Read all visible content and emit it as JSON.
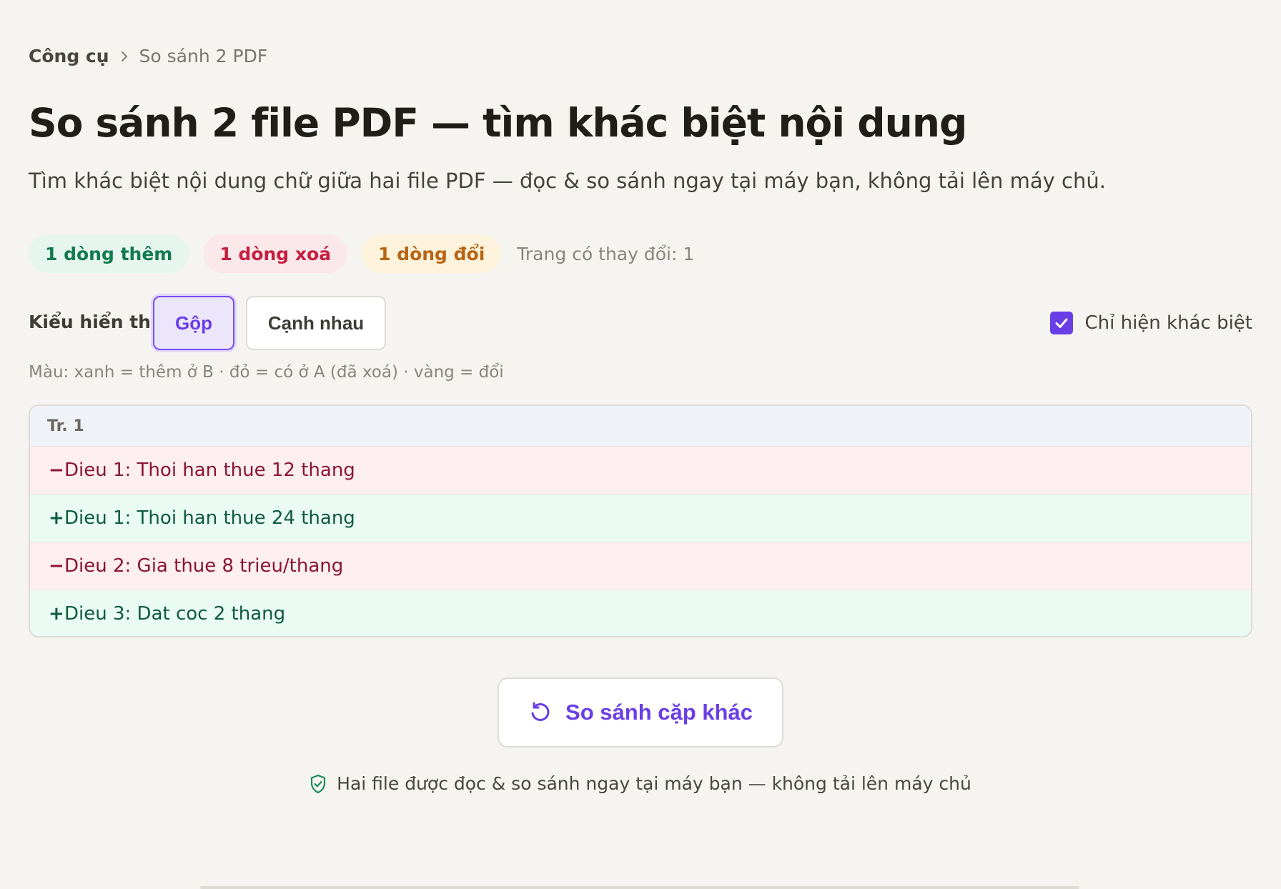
{
  "breadcrumb": {
    "parent": "Công cụ",
    "current": "So sánh 2 PDF"
  },
  "title": "So sánh 2 file PDF — tìm khác biệt nội dung",
  "subtitle": "Tìm khác biệt nội dung chữ giữa hai file PDF — đọc & so sánh ngay tại máy bạn, không tải lên máy chủ.",
  "summary": {
    "added": "1 dòng thêm",
    "removed": "1 dòng xoá",
    "changed": "1 dòng đổi",
    "pages_changed": "Trang có thay đổi: 1"
  },
  "view_mode": {
    "label": "Kiểu hiển thị",
    "options": [
      {
        "label": "Gộp",
        "selected": true
      },
      {
        "label": "Cạnh nhau",
        "selected": false
      }
    ],
    "diff_only_label": "Chỉ hiện khác biệt",
    "diff_only_checked": true
  },
  "legend": "Màu: xanh = thêm ở B · đỏ = có ở A (đã xoá) · vàng = đổi",
  "diff": {
    "page_label": "Tr. 1",
    "rows": [
      {
        "type": "removed",
        "sign": "−",
        "text": "Dieu 1: Thoi han thue 12 thang"
      },
      {
        "type": "added",
        "sign": "+",
        "text": "Dieu 1: Thoi han thue 24 thang"
      },
      {
        "type": "removed",
        "sign": "−",
        "text": "Dieu 2: Gia thue 8 trieu/thang"
      },
      {
        "type": "added",
        "sign": "+",
        "text": "Dieu 3: Dat coc 2 thang"
      }
    ]
  },
  "compare_again_label": "So sánh cặp khác",
  "privacy_note": "Hai file được đọc & so sánh ngay tại máy bạn — không tải lên máy chủ",
  "colors": {
    "accent": "#6a3ee6",
    "added_bg": "#e9fbf3",
    "removed_bg": "#fdeeef",
    "changed_bg": "#fdf3dd"
  },
  "icons": [
    "chevron-right-icon",
    "check-icon",
    "refresh-icon",
    "shield-check-icon"
  ]
}
